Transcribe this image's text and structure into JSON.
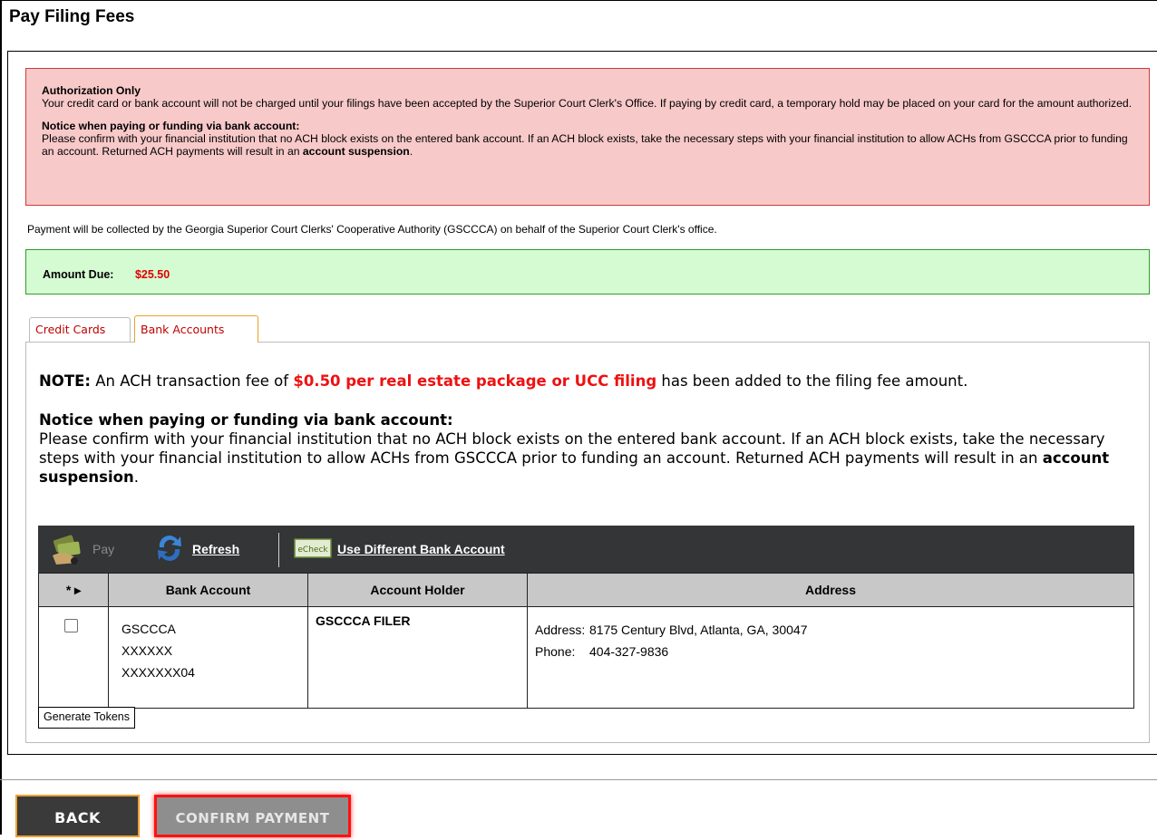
{
  "page": {
    "title": "Pay Filing Fees"
  },
  "alert": {
    "heading1": "Authorization Only",
    "text1": "Your credit card or bank account will not be charged until your filings have been accepted by the Superior Court Clerk's Office. If paying by credit card, a temporary hold may be placed on your card for the amount authorized.",
    "heading2": "Notice when paying or funding via bank account:",
    "text2_pre": "Please confirm with your financial institution that no ACH block exists on the entered bank account. If an ACH block exists, take the necessary steps with your financial institution to allow ACHs from GSCCCA prior to funding an account. Returned ACH payments will result in an ",
    "text2_bold": "account suspension",
    "text2_post": "."
  },
  "collection_note": "Payment will be collected by the Georgia Superior Court Clerks' Cooperative Authority (GSCCCA) on behalf of the Superior Court Clerk's office.",
  "amount": {
    "label": "Amount Due:",
    "value": "$25.50"
  },
  "tabs": [
    {
      "label": "Credit Cards"
    },
    {
      "label": "Bank Accounts"
    }
  ],
  "panel": {
    "note_label": "NOTE:",
    "note_pre": " An ACH transaction fee of ",
    "note_highlight": "$0.50 per real estate package or UCC filing",
    "note_post": " has been added to the filing fee amount.",
    "notice_heading": "Notice when paying or funding via bank account:",
    "notice_pre": "Please confirm with your financial institution that no ACH block exists on the entered bank account. If an ACH block exists, take the necessary steps with your financial institution to allow ACHs from GSCCCA prior to funding an account. Returned ACH payments will result in an ",
    "notice_bold": "account suspension",
    "notice_post": "."
  },
  "toolbar": {
    "pay_label": "Pay",
    "refresh_label": "Refresh",
    "different_account_label": "Use Different Bank Account",
    "echeck_icon_text": "eCheck"
  },
  "table": {
    "headers": {
      "select": "* ▸",
      "bank_account": "Bank Account",
      "account_holder": "Account Holder",
      "address": "Address"
    },
    "rows": [
      {
        "bank_line1": "GSCCCA",
        "bank_line2": "XXXXXX",
        "bank_line3": "XXXXXXX04",
        "holder": "GSCCCA FILER",
        "address_label": "Address:",
        "address_value": "8175 Century Blvd, Atlanta, GA, 30047",
        "phone_label": "Phone:",
        "phone_value": "404-327-9836"
      }
    ]
  },
  "generate_tokens_label": "Generate Tokens",
  "buttons": {
    "back": "BACK",
    "confirm": "CONFIRM PAYMENT"
  },
  "colors": {
    "alert_bg": "#f8c9c9",
    "amount_bg": "#d5fbd3",
    "amount_value": "#e00000",
    "highlight": "#ee1111",
    "confirm_border": "#ff1111"
  }
}
